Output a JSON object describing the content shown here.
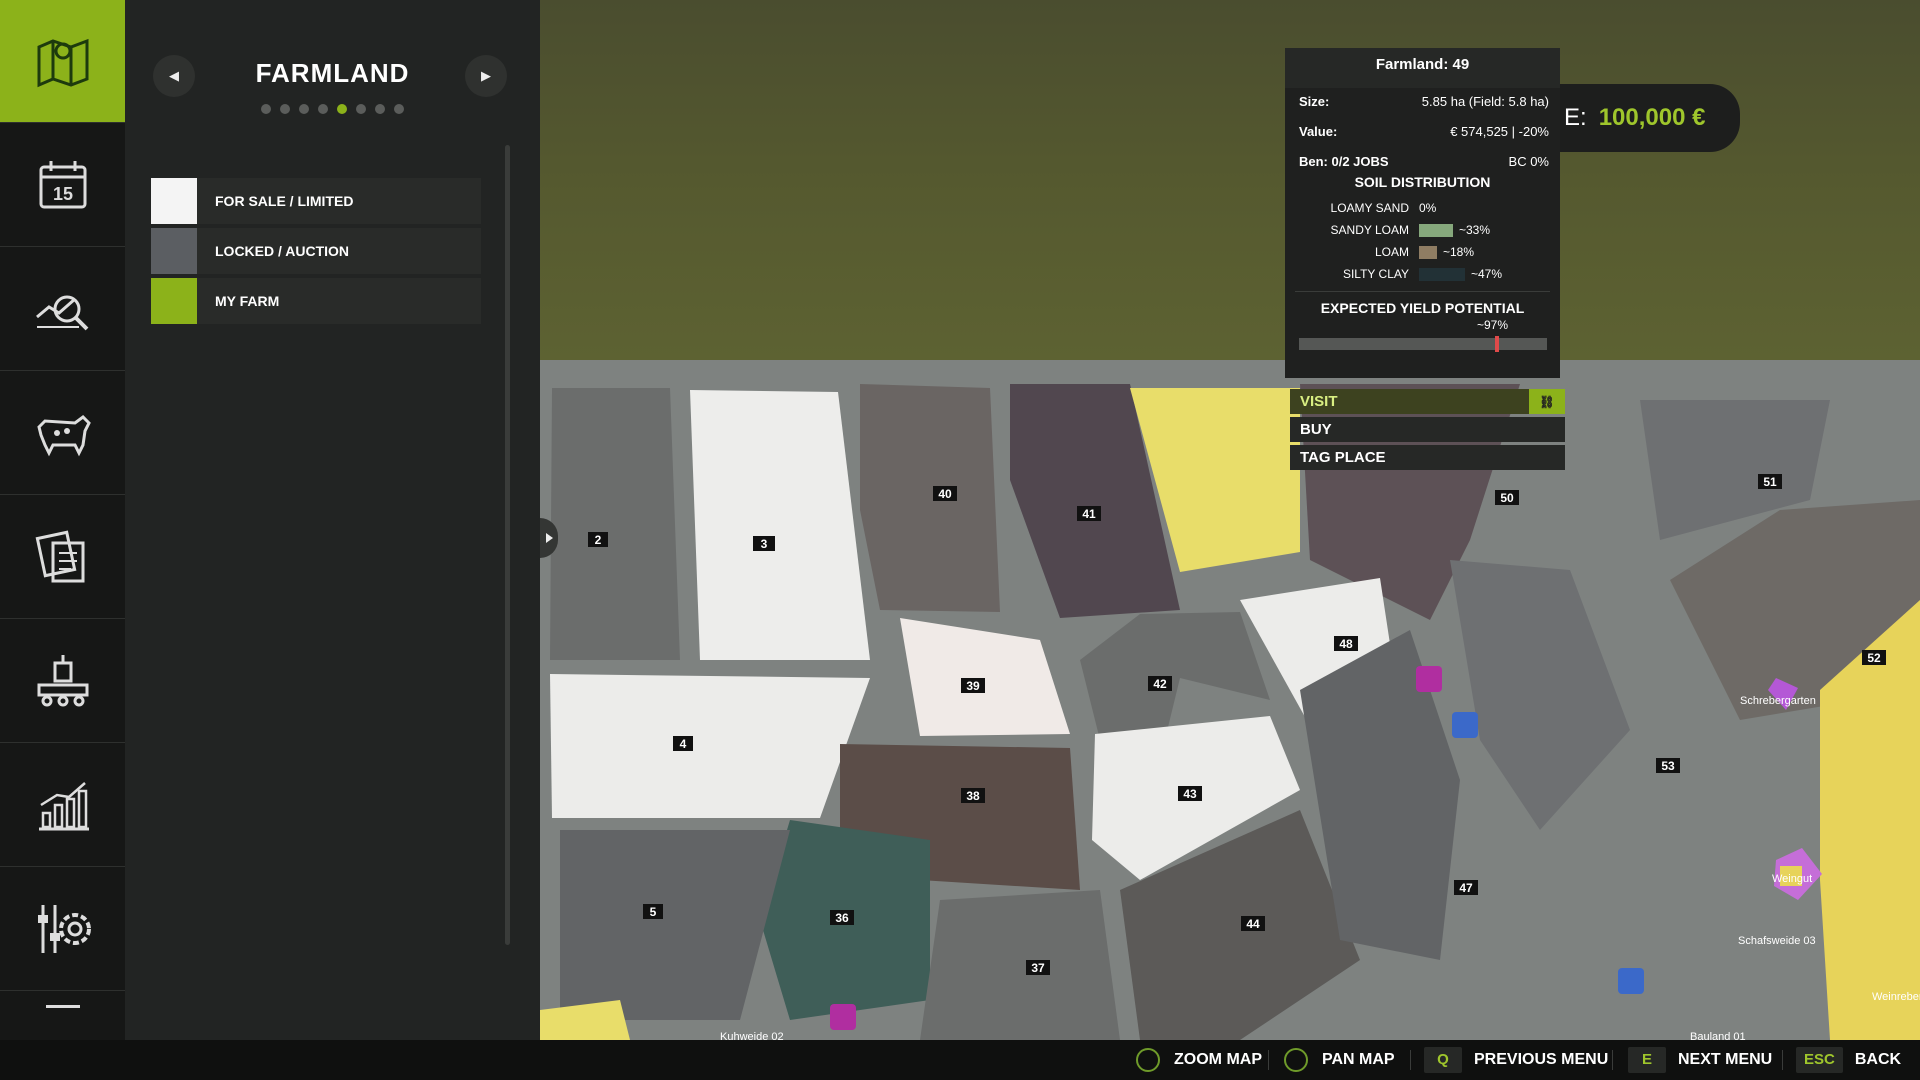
{
  "panel": {
    "title": "FARMLAND",
    "page_count": 8,
    "active_page": 5,
    "legend": [
      {
        "label": "FOR SALE / LIMITED",
        "color": "#f4f4f4"
      },
      {
        "label": "LOCKED / AUCTION",
        "color": "#5b5e62"
      },
      {
        "label": "MY FARM",
        "color": "#8cb21a"
      }
    ]
  },
  "sidebar_icons": [
    "map-icon",
    "calendar-icon",
    "prices-icon",
    "animals-icon",
    "contracts-icon",
    "production-icon",
    "statistics-icon",
    "settings-icon"
  ],
  "calendar_day": "15",
  "money": {
    "prefix": "E:",
    "amount": "100,000 €"
  },
  "info": {
    "title": "Farmland: 49",
    "size_label": "Size:",
    "size_value": "5.85 ha (Field: 5.8 ha)",
    "value_label": "Value:",
    "value_value": "€ 574,525 | -20%",
    "jobs_label": "Ben: 0/2 JOBS",
    "bc_value": "BC 0%",
    "soil_title": "SOIL DISTRIBUTION",
    "soil": [
      {
        "name": "LOAMY SAND",
        "pct": "0%",
        "color": "#1f201f"
      },
      {
        "name": "SANDY LOAM",
        "pct": "~33%",
        "color": "#86a87c"
      },
      {
        "name": "LOAM",
        "pct": "~18%",
        "color": "#8f7d63"
      },
      {
        "name": "SILTY CLAY",
        "pct": "~47%",
        "color": "#223136"
      }
    ],
    "yield_title": "EXPECTED YIELD POTENTIAL",
    "yield_pct": "~97%",
    "yield_fraction": 0.79
  },
  "context_menu": {
    "visit": "VISIT",
    "buy": "BUY",
    "tag": "TAG PLACE"
  },
  "map": {
    "fields": [
      "2",
      "3",
      "4",
      "5",
      "36",
      "37",
      "38",
      "39",
      "40",
      "41",
      "42",
      "43",
      "44",
      "47",
      "48",
      "50",
      "51",
      "52",
      "53"
    ],
    "places": [
      "Schrebergarten",
      "Weingut",
      "Schafsweide 03",
      "Bauland 01",
      "Kuhweide 02",
      "Weinreben"
    ]
  },
  "bottom_bar": {
    "zoom": "ZOOM MAP",
    "pan": "PAN MAP",
    "prev_key": "Q",
    "prev": "PREVIOUS MENU",
    "next_key": "E",
    "next": "NEXT MENU",
    "back_key": "ESC",
    "back": "BACK"
  }
}
